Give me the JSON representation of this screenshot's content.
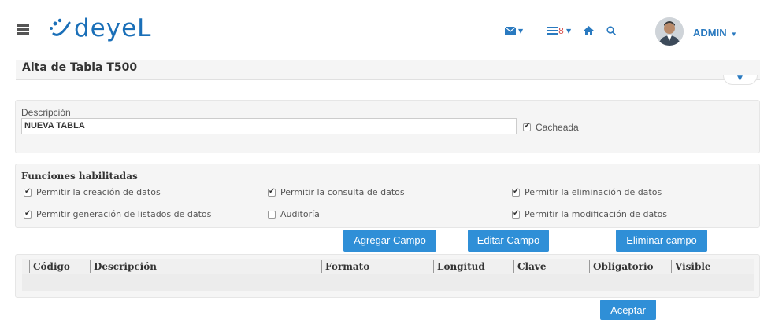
{
  "header": {
    "logo_text": "deyeL",
    "user_name": "ADMIN",
    "nav_icons": [
      "menu-icon",
      "mail-icon",
      "calendar-icon",
      "home-icon",
      "search-icon"
    ]
  },
  "page": {
    "title": "Alta de Tabla T500"
  },
  "form": {
    "description_label": "Descripción",
    "description_value": "NUEVA TABLA",
    "cached_label": "Cacheada",
    "cached_checked": true
  },
  "functions": {
    "title": "Funciones habilitadas",
    "items": [
      {
        "label": "Permitir la creación de datos",
        "checked": true
      },
      {
        "label": "Permitir la consulta de datos",
        "checked": true
      },
      {
        "label": "Permitir la eliminación de datos",
        "checked": true
      },
      {
        "label": "Permitir generación de listados de datos",
        "checked": true
      },
      {
        "label": "Auditoría",
        "checked": false
      },
      {
        "label": "Permitir la modificación de datos",
        "checked": true
      }
    ]
  },
  "actions": {
    "add_field": "Agregar Campo",
    "edit_field": "Editar Campo",
    "delete_field": "Eliminar campo",
    "accept": "Aceptar"
  },
  "grid": {
    "columns": [
      "Código",
      "Descripción",
      "Formato",
      "Longitud",
      "Clave",
      "Obligatorio",
      "Visible"
    ],
    "rows": []
  },
  "colors": {
    "accent": "#2f8fd7",
    "brand": "#1a6fb8",
    "panel_bg": "#f5f5f5"
  }
}
